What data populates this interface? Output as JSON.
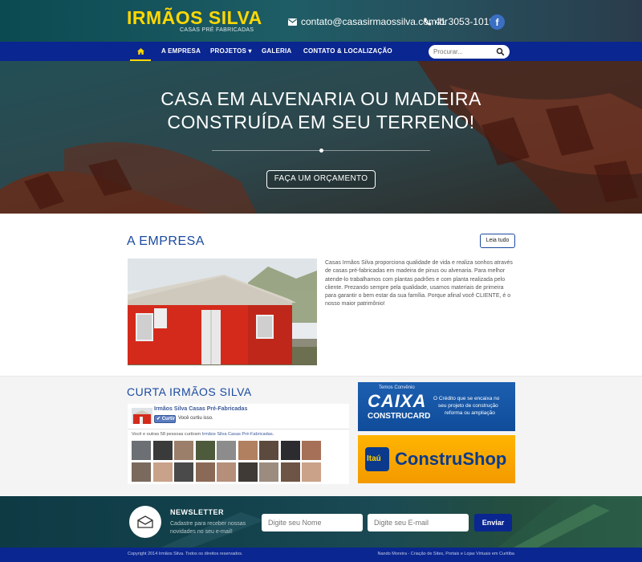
{
  "header": {
    "logo_main": "IRMÃOS SILVA",
    "logo_sub": "CASAS PRÉ FABRICADAS",
    "email": "contato@casasirmaossilva.com.br",
    "phone": "41 3053-1019",
    "facebook_icon": "f"
  },
  "nav": {
    "home_icon": "home-icon",
    "items": [
      {
        "label": "A EMPRESA"
      },
      {
        "label": "PROJETOS ▾"
      },
      {
        "label": "GALERIA"
      },
      {
        "label": "CONTATO & LOCALIZAÇÃO"
      }
    ],
    "search_placeholder": "Procurar..."
  },
  "hero": {
    "title_line1": "CASA EM ALVENARIA OU MADEIRA",
    "title_line2": "CONSTRUÍDA EM SEU TERRENO!",
    "button": "FAÇA UM ORÇAMENTO"
  },
  "empresa": {
    "title": "A EMPRESA",
    "read_more": "Leia tudo",
    "text": "Casas Irmãos Silva proporciona qualidade de vida e realiza sonhos através de casas pré-fabricadas em madeira de pinus ou alvenaria. Para melhor atende-lo trabalhamos com plantas padrões e com planta realizada pelo cliente. Prezando sempre pela qualidade, usamos materiais de primeira para garantir o bem estar da sua família. Porque afinal você CLIENTE, é o nosso maior patrimônio!"
  },
  "curta": {
    "title": "CURTA IRMÃOS SILVA",
    "page_name": "Irmãos Silva Casas Pré-Fabricadas",
    "like_button": "Curtir",
    "like_text": "Você curtiu isso.",
    "people_prefix": "Você e outras 58 pessoas curtiram ",
    "people_link": "Irmãos Silva Casas Pré-Fabricadas."
  },
  "ads": {
    "caixa_top": "Temos Convênio",
    "caixa_brand": "CAIXA",
    "caixa_product": "CONSTRUCARD",
    "caixa_text1": "O Crédito que se encaixa no",
    "caixa_text2": "seu projeto de construção",
    "caixa_text3": "reforma ou ampliação",
    "itau_logo": "Itaú",
    "itau_text": "ConstruShop"
  },
  "newsletter": {
    "title": "NEWSLETTER",
    "subtitle": "Cadastre para receber nossas novidades no seu e-mail!",
    "name_placeholder": "Digite seu Nome",
    "email_placeholder": "Digite seu E-mail",
    "button": "Enviar"
  },
  "footer": {
    "left": "Copyright 2014 Irmãos Silva. Todos os direitos reservados.",
    "right": "Nando Moreira - Criação de Sites, Portais e Lojas Virtuais em Curitiba"
  },
  "colors": {
    "nav_blue": "#0a2690",
    "logo_yellow": "#ffd800",
    "section_blue": "#1b4aa0",
    "caixa_blue": "#0f4c9a",
    "itau_orange": "#f39a00"
  }
}
